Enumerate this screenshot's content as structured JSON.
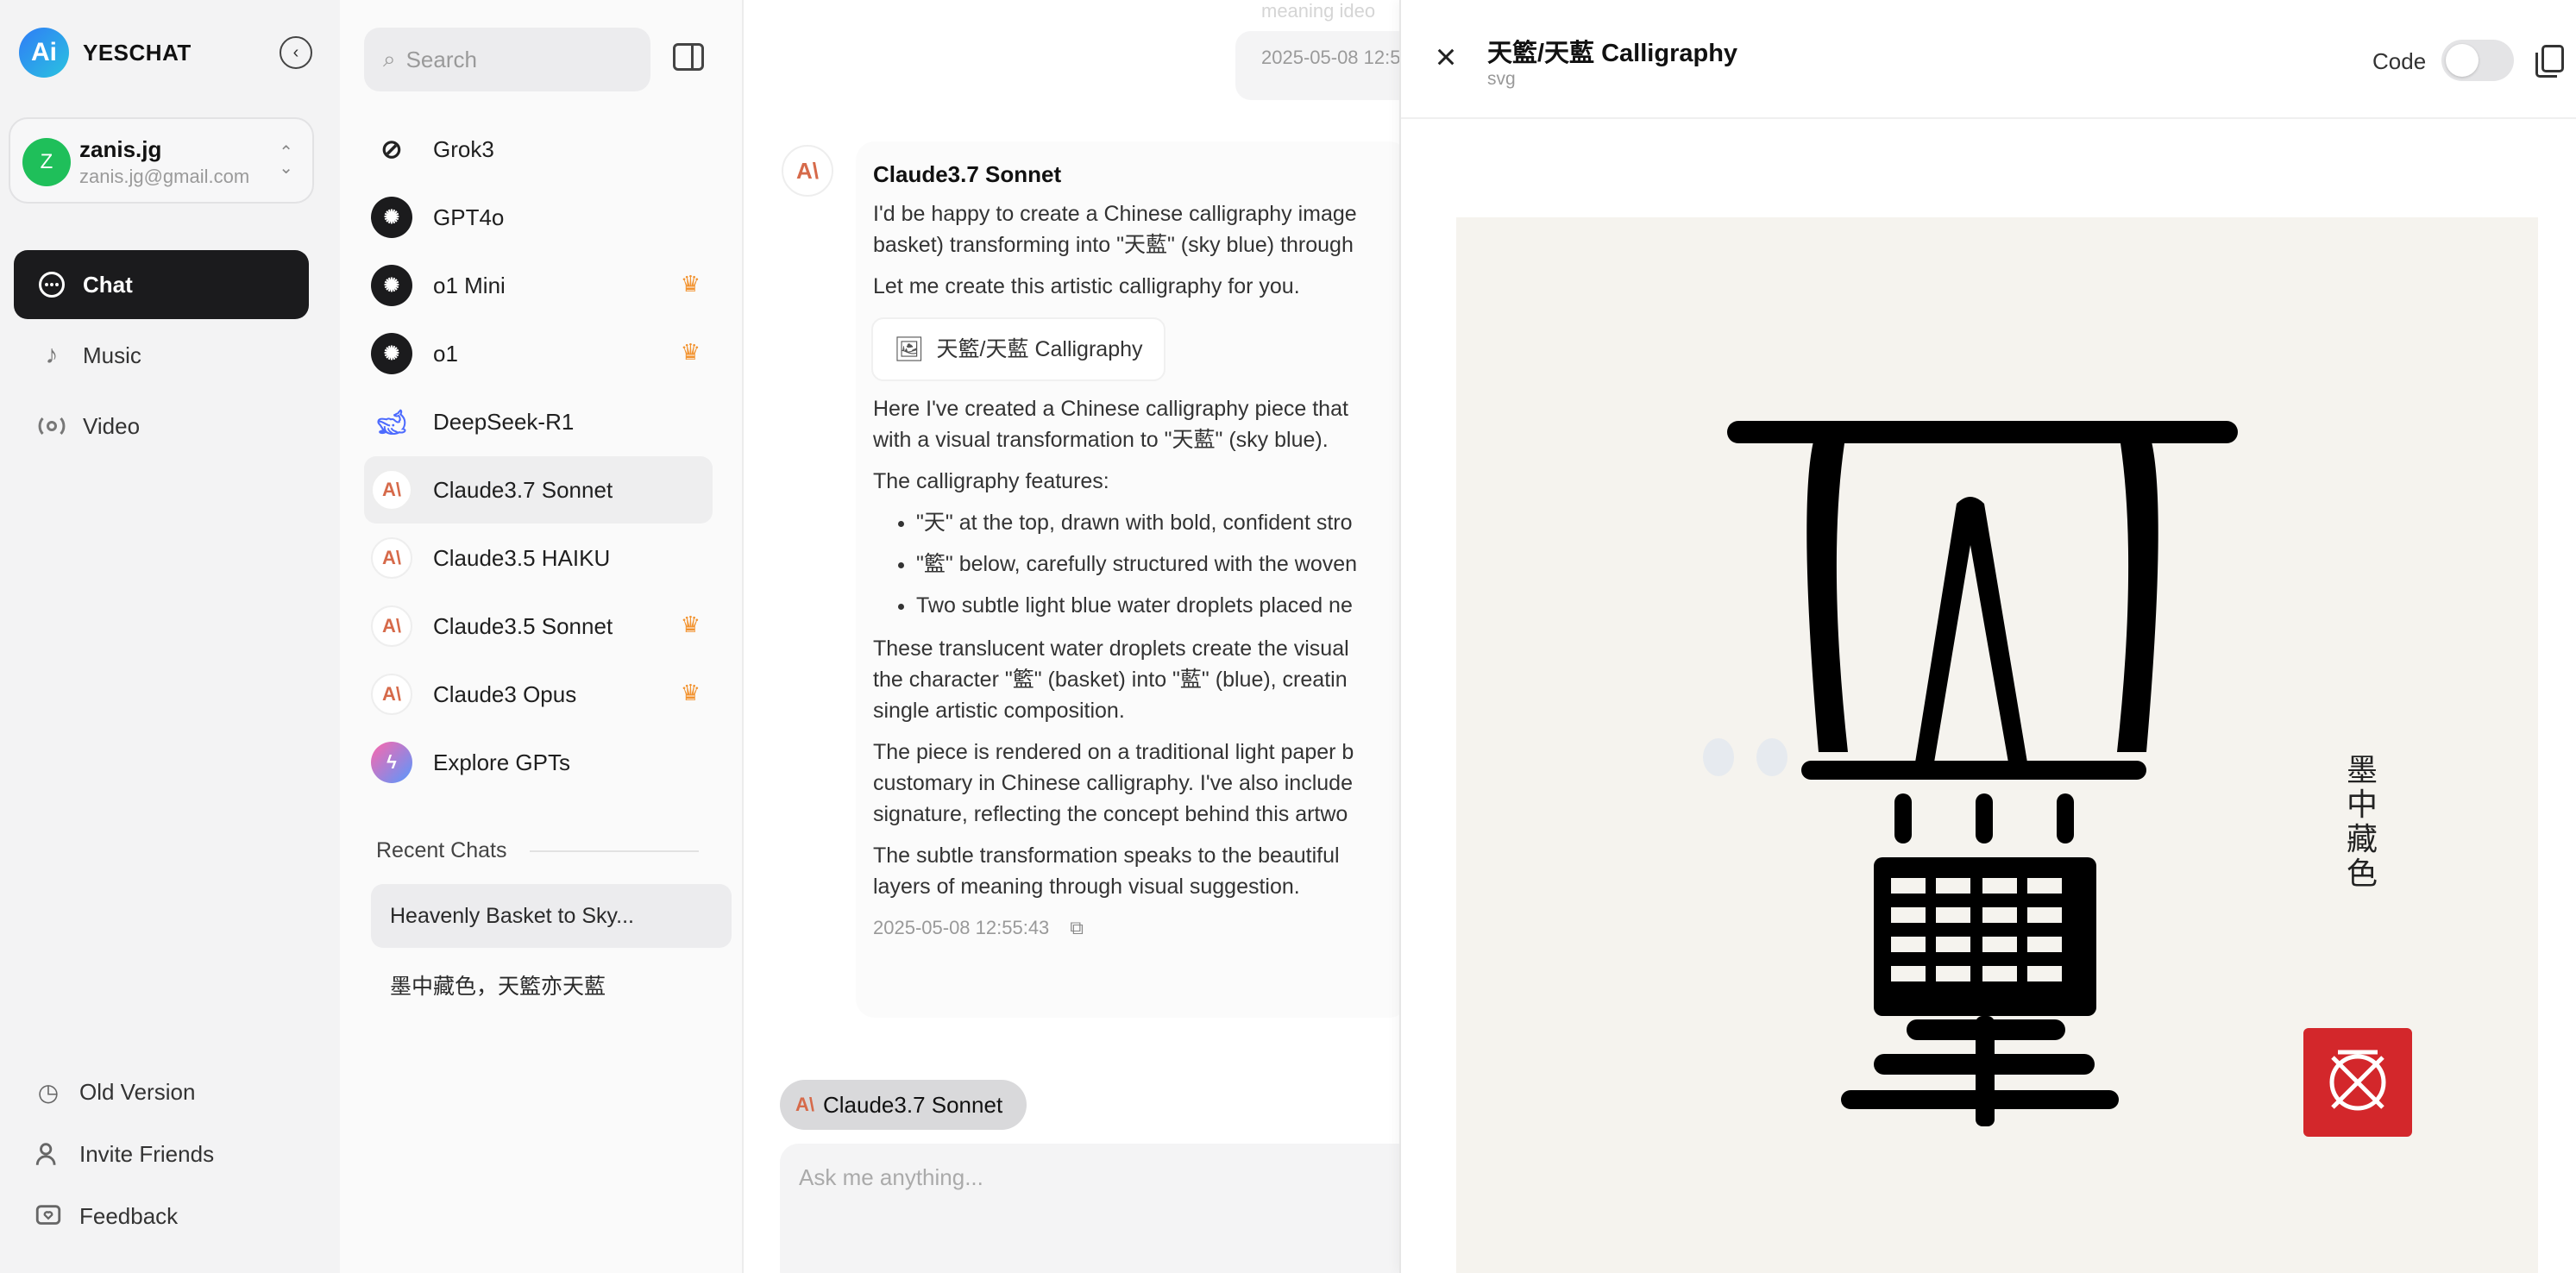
{
  "brand": {
    "name": "YESCHAT",
    "logo_text": "Ai"
  },
  "account": {
    "initial": "Z",
    "name": "zanis.jg",
    "email": "zanis.jg@gmail.com"
  },
  "nav": {
    "items": [
      {
        "label": "Chat",
        "icon": "chat-bubble-icon"
      },
      {
        "label": "Music",
        "icon": "music-note-icon"
      },
      {
        "label": "Video",
        "icon": "video-icon"
      }
    ],
    "bottom": [
      {
        "label": "Old Version",
        "icon": "clock-icon"
      },
      {
        "label": "Invite Friends",
        "icon": "user-add-icon"
      },
      {
        "label": "Feedback",
        "icon": "feedback-icon"
      }
    ]
  },
  "search": {
    "placeholder": "Search"
  },
  "models": [
    {
      "label": "Grok3",
      "icon": "grok-icon",
      "premium": false
    },
    {
      "label": "GPT4o",
      "icon": "openai-icon",
      "premium": false
    },
    {
      "label": "o1 Mini",
      "icon": "openai-icon",
      "premium": true
    },
    {
      "label": "o1",
      "icon": "openai-icon",
      "premium": true
    },
    {
      "label": "DeepSeek-R1",
      "icon": "deepseek-icon",
      "premium": false
    },
    {
      "label": "Claude3.7 Sonnet",
      "icon": "anthropic-icon",
      "premium": false
    },
    {
      "label": "Claude3.5 HAIKU",
      "icon": "anthropic-icon",
      "premium": false
    },
    {
      "label": "Claude3.5 Sonnet",
      "icon": "anthropic-icon",
      "premium": true
    },
    {
      "label": "Claude3 Opus",
      "icon": "anthropic-icon",
      "premium": true
    },
    {
      "label": "Explore GPTs",
      "icon": "explore-icon",
      "premium": false
    }
  ],
  "recent": {
    "title": "Recent Chats",
    "items": [
      "Heavenly Basket to Sky...",
      "墨中藏色，天籃亦天藍"
    ]
  },
  "chat": {
    "top_fade": "meaning  ideo",
    "user_timestamp": "2025-05-08 12:5",
    "model_name": "Claude3.7 Sonnet",
    "p1": "I'd be happy to create a Chinese calligraphy image",
    "p1b": "basket) transforming into \"天藍\" (sky blue) through",
    "p2": "Let me create this artistic calligraphy for you.",
    "artifact_label": "天籃/天藍 Calligraphy",
    "p3": "Here I've created a Chinese calligraphy piece that",
    "p3b": "with a visual transformation to \"天藍\" (sky blue).",
    "p4": "The calligraphy features:",
    "bullets": [
      "\"天\" at the top, drawn with bold, confident stro",
      "\"籃\" below, carefully structured with the woven",
      "Two subtle light blue water droplets placed ne"
    ],
    "p5a": "These translucent water droplets create the visual",
    "p5b": "the character \"籃\" (basket) into \"藍\" (blue), creatin",
    "p5c": "single artistic composition.",
    "p6a": "The piece is rendered on a traditional light paper b",
    "p6b": "customary in Chinese calligraphy. I've also include",
    "p6c": "signature, reflecting the concept behind this artwo",
    "p7a": "The subtle transformation speaks to the beautiful",
    "p7b": "layers of meaning through visual suggestion.",
    "timestamp": "2025-05-08 12:55:43"
  },
  "composer": {
    "model_pill": "Claude3.7 Sonnet",
    "placeholder": "Ask me anything..."
  },
  "artifact": {
    "title": "天籃/天藍 Calligraphy",
    "subtitle": "svg",
    "code_label": "Code",
    "code_toggle_on": false,
    "signature": "墨中藏色",
    "colors": {
      "paper": "#f5f3ee",
      "ink": "#000000",
      "seal": "#d3272b",
      "droplet": "#e6eaef"
    }
  }
}
